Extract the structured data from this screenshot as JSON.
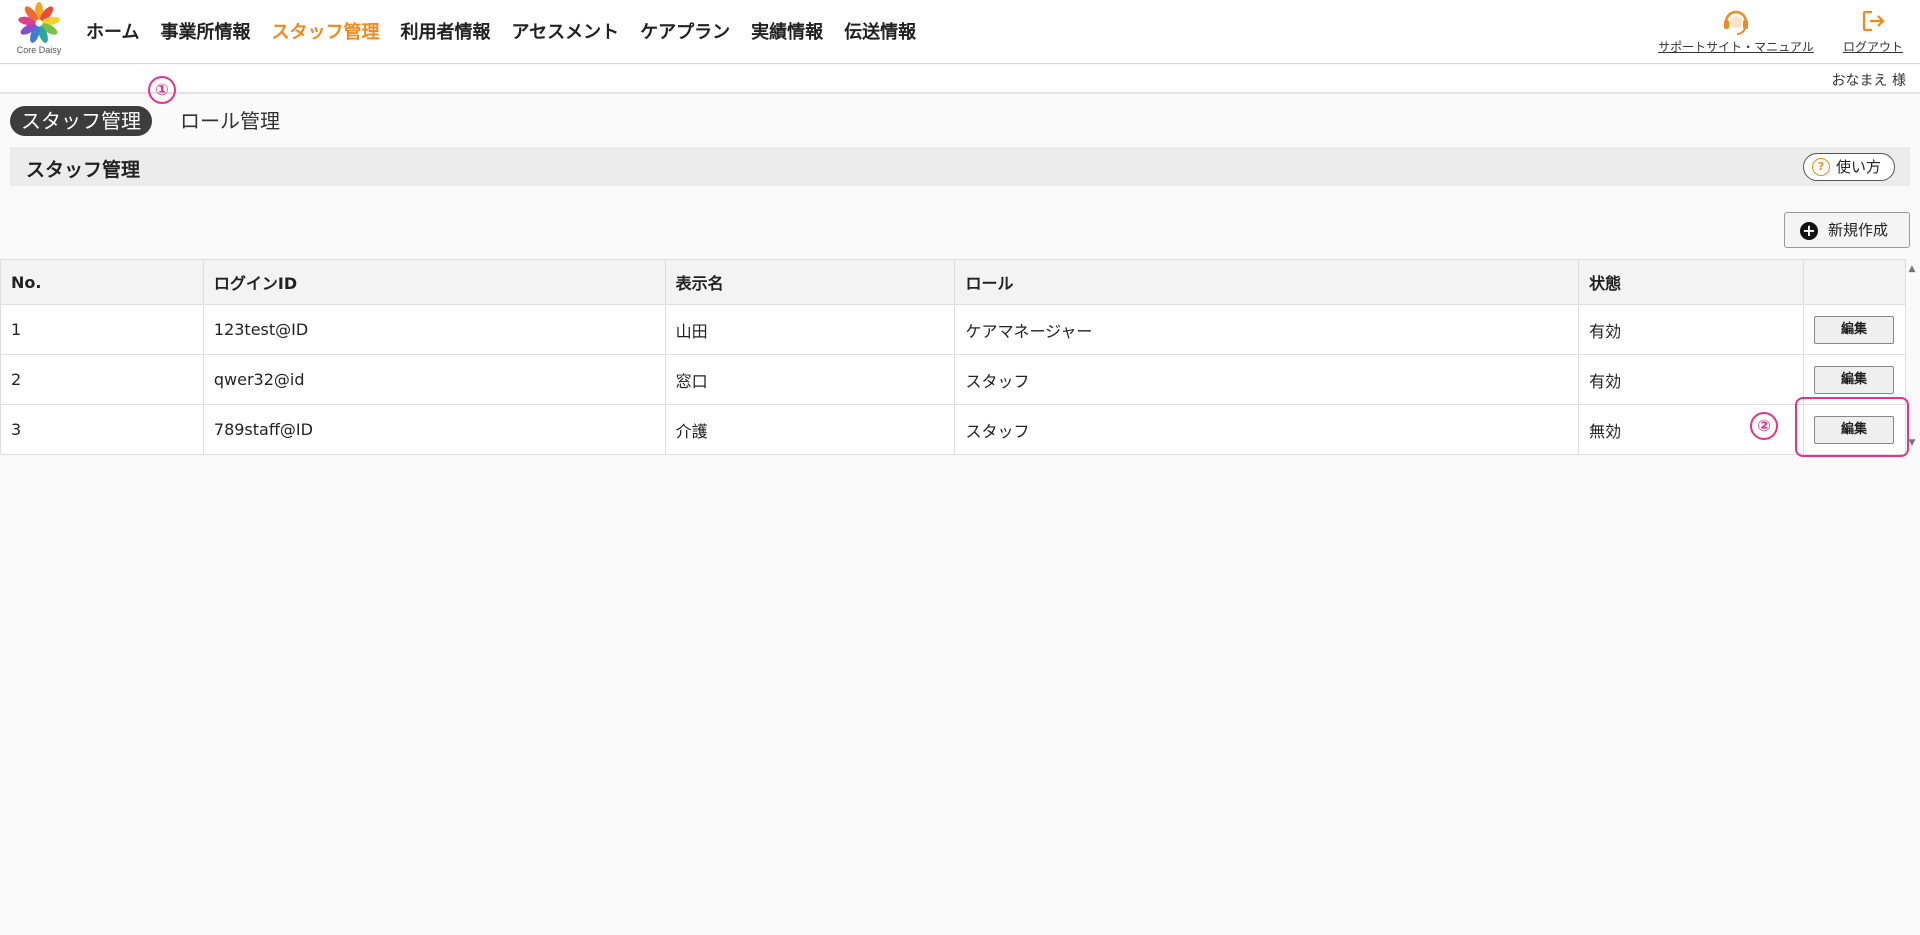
{
  "header": {
    "logo_text": "Core Daisy",
    "nav": [
      {
        "label": "ホーム",
        "active": false
      },
      {
        "label": "事業所情報",
        "active": false
      },
      {
        "label": "スタッフ管理",
        "active": true
      },
      {
        "label": "利用者情報",
        "active": false
      },
      {
        "label": "アセスメント",
        "active": false
      },
      {
        "label": "ケアプラン",
        "active": false
      },
      {
        "label": "実績情報",
        "active": false
      },
      {
        "label": "伝送情報",
        "active": false
      }
    ],
    "support_label": "サポートサイト・マニュアル",
    "logout_label": "ログアウト",
    "support_icon": "headset-icon",
    "logout_icon": "logout-icon",
    "accent_color": "#f08a1c"
  },
  "user": {
    "name": "おなまえ 様"
  },
  "tabs": {
    "active": "スタッフ管理",
    "other": "ロール管理"
  },
  "section": {
    "title": "スタッフ管理",
    "help_label": "使い方"
  },
  "actions": {
    "new_label": "新規作成"
  },
  "table": {
    "columns": [
      "No.",
      "ログインID",
      "表示名",
      "ロール",
      "状態",
      ""
    ],
    "rows": [
      {
        "no": "1",
        "login_id": "123test@ID",
        "display_name": "山田",
        "role": "ケアマネージャー",
        "status": "有効",
        "action": "編集"
      },
      {
        "no": "2",
        "login_id": "qwer32@id",
        "display_name": "窓口",
        "role": "スタッフ",
        "status": "有効",
        "action": "編集"
      },
      {
        "no": "3",
        "login_id": "789staff@ID",
        "display_name": "介護",
        "role": "スタッフ",
        "status": "無効",
        "action": "編集"
      }
    ]
  },
  "annotations": {
    "marker1": "①",
    "marker2": "②",
    "color": "#e6338a"
  }
}
